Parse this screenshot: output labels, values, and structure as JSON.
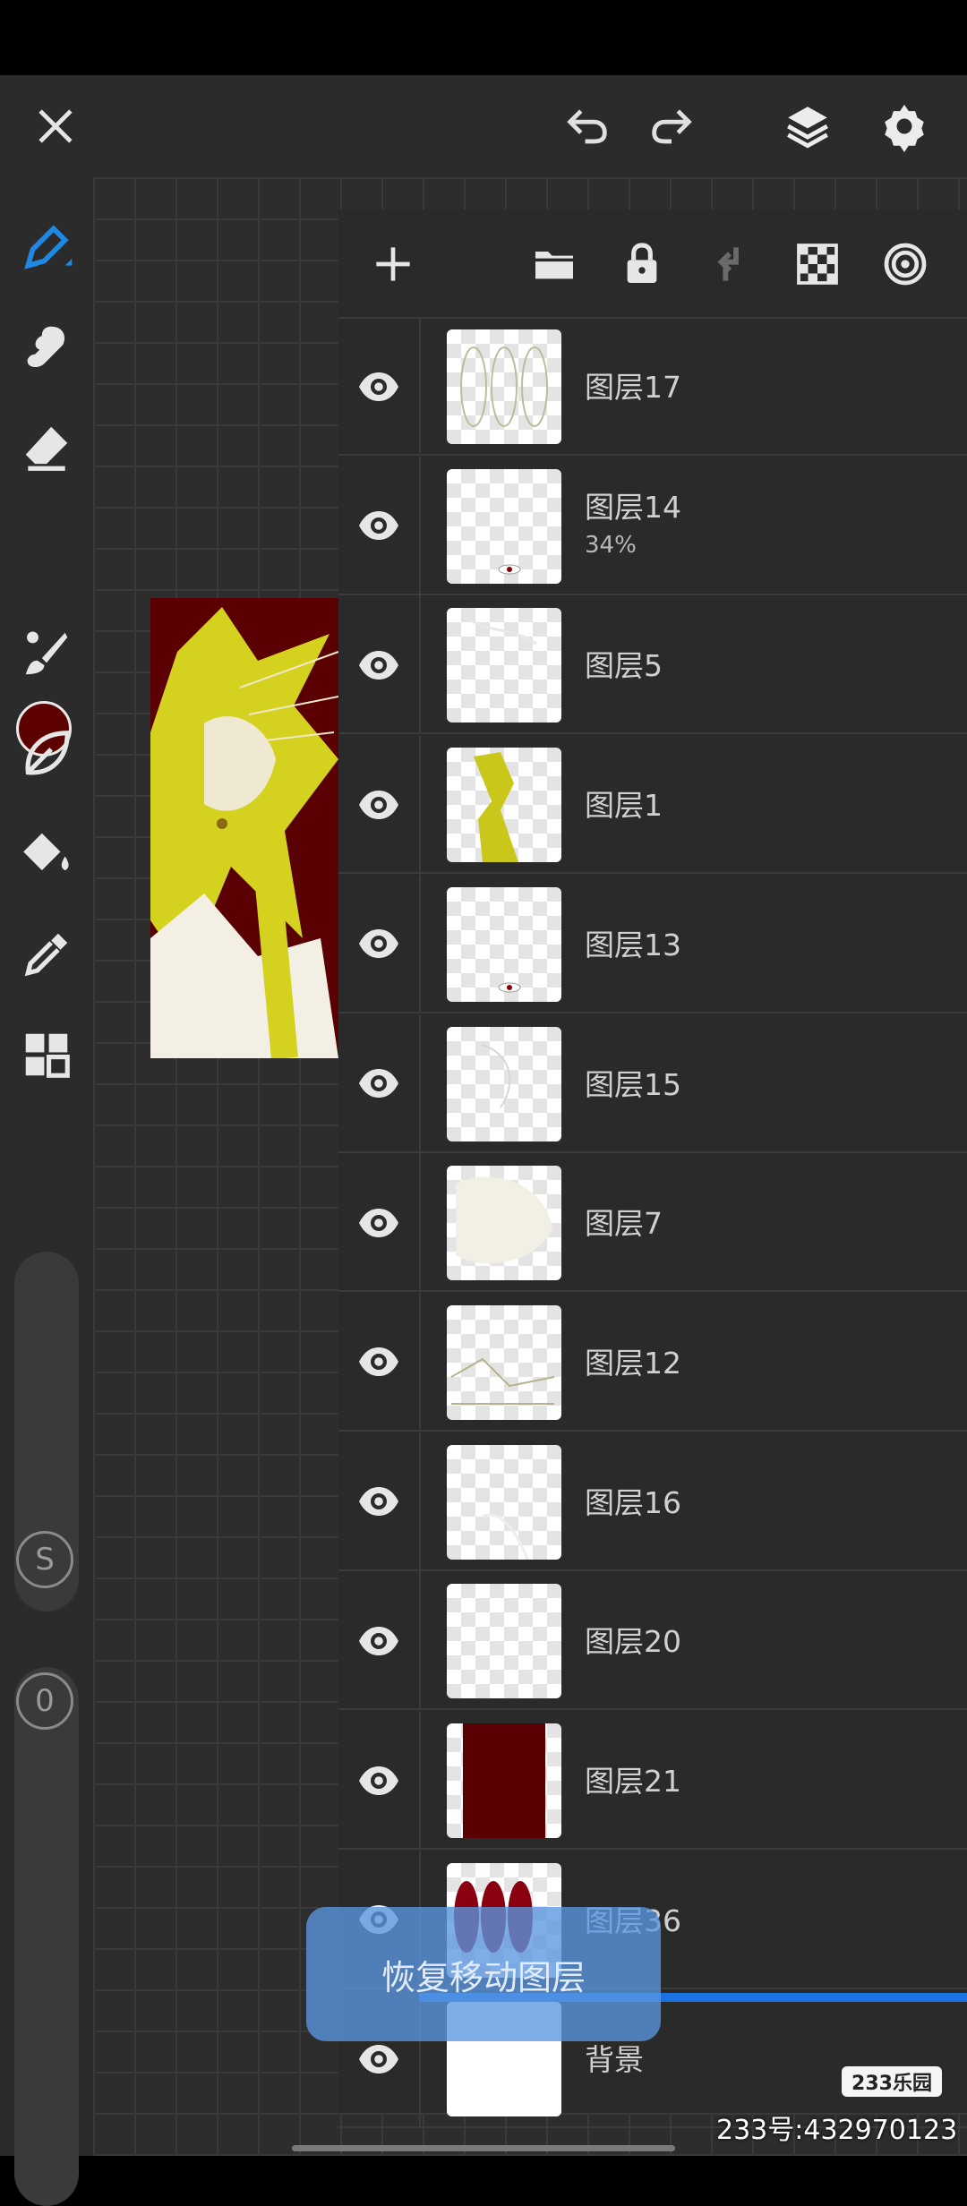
{
  "top_bar": {
    "icons": [
      "close-icon",
      "undo-icon",
      "redo-icon",
      "layers-icon",
      "settings-icon"
    ],
    "accent": "#1e88e5"
  },
  "sidebar": {
    "tools": [
      "pen-icon",
      "smudge-icon",
      "eraser-icon",
      "color-swatch",
      "brush-icon",
      "leaf-icon",
      "fill-icon",
      "eyedropper-icon",
      "grid-icon"
    ],
    "current_color": "#5c0000",
    "size_badge": "S",
    "opacity_badge": "0"
  },
  "layers_panel": {
    "toolbar_icons": [
      "add-layer-icon",
      "folder-icon",
      "lock-icon",
      "merge-down-icon",
      "checker-icon",
      "target-icon"
    ],
    "layers": [
      {
        "name": "图层17",
        "opacity": ""
      },
      {
        "name": "图层14",
        "opacity": "34%"
      },
      {
        "name": "图层5",
        "opacity": ""
      },
      {
        "name": "图层1",
        "opacity": ""
      },
      {
        "name": "图层13",
        "opacity": ""
      },
      {
        "name": "图层15",
        "opacity": ""
      },
      {
        "name": "图层7",
        "opacity": ""
      },
      {
        "name": "图层12",
        "opacity": ""
      },
      {
        "name": "图层16",
        "opacity": ""
      },
      {
        "name": "图层20",
        "opacity": ""
      },
      {
        "name": "图层21",
        "opacity": ""
      },
      {
        "name": "图层36",
        "opacity": ""
      },
      {
        "name": "背景",
        "opacity": ""
      }
    ]
  },
  "toast": {
    "text": "恢复移动图层"
  },
  "watermark": {
    "logo": "233乐园",
    "id": "233号:432970123"
  }
}
